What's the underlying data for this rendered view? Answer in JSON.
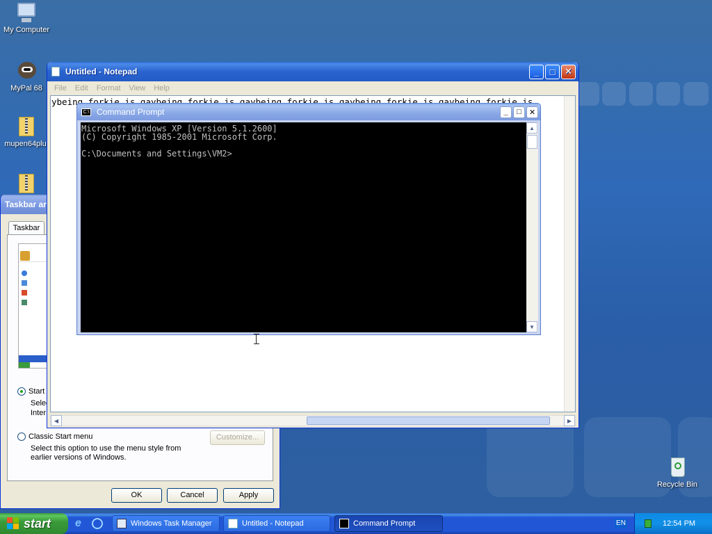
{
  "desktop": {
    "icons": [
      {
        "label": "My Computer"
      },
      {
        "label": "MyPal 68"
      },
      {
        "label": "mupen64plu."
      },
      {
        "label": ""
      },
      {
        "label": "Recycle Bin"
      }
    ]
  },
  "notepad": {
    "title": "Untitled - Notepad",
    "menu": [
      "File",
      "Edit",
      "Format",
      "View",
      "Help"
    ],
    "text": "ybeing forkie is gaybeing forkie is gaybeing forkie is gaybeing forkie is gaybeing forkie is"
  },
  "cmd": {
    "title": "Command Prompt",
    "lines": [
      "Microsoft Windows XP [Version 5.1.2600]",
      "(C) Copyright 1985-2001 Microsoft Corp.",
      "",
      "C:\\Documents and Settings\\VM2>"
    ]
  },
  "props": {
    "title": "Taskbar an",
    "tab": "Taskbar",
    "start_option_label": "Start",
    "start_option_desc": "Selec\nInter",
    "classic_label": "Classic Start menu",
    "classic_desc_1": "Select this option to use the menu style from",
    "classic_desc_2": "earlier versions of Windows.",
    "customize": "Customize...",
    "ok": "OK",
    "cancel": "Cancel",
    "apply": "Apply",
    "start_option_selected": true
  },
  "taskbar": {
    "start": "start",
    "tasks": [
      {
        "label": "Windows Task Manager",
        "active": false
      },
      {
        "label": "Untitled - Notepad",
        "active": false
      },
      {
        "label": "Command Prompt",
        "active": true
      }
    ],
    "lang": "EN",
    "clock": "12:54 PM"
  },
  "colors": {
    "desktop": "#2f6ab8",
    "title_active": "#0a4fd0",
    "start_green": "#3a9b3a"
  }
}
